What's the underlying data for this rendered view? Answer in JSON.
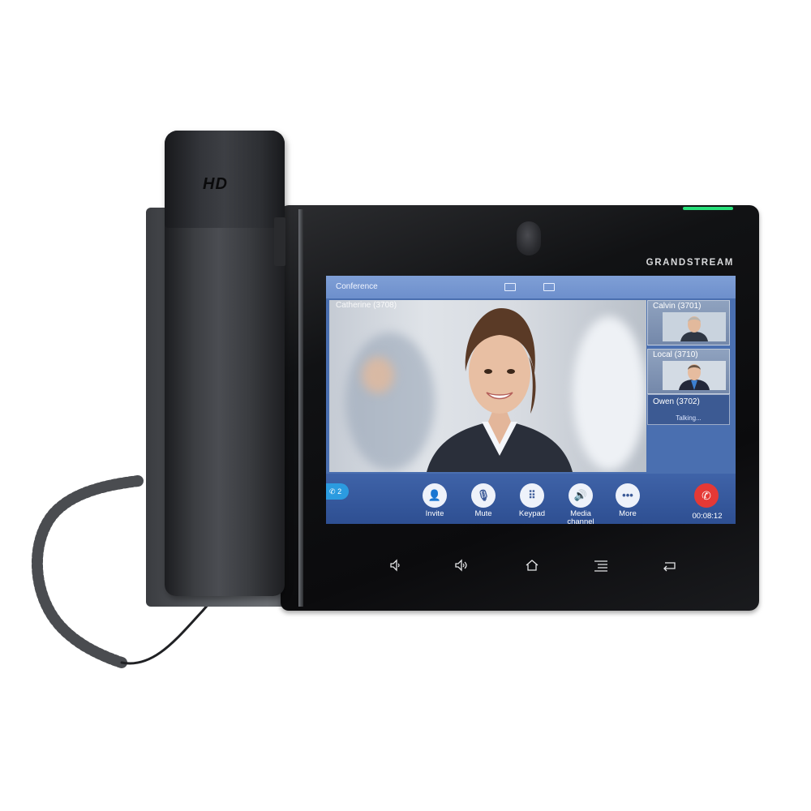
{
  "device": {
    "brand": "GRANDSTREAM",
    "handset_logo": "HD",
    "led_color": "#28e07a"
  },
  "screen": {
    "title": "Conference",
    "layout_icons": [
      "layout-split-icon",
      "layout-grid-icon"
    ],
    "main_video": {
      "caller_name": "Catherine (3708)"
    },
    "participants": [
      {
        "name": "Calvin (3701)"
      },
      {
        "name": "Local (3710)"
      },
      {
        "name": "Owen (3702)",
        "status": "Talking..."
      }
    ],
    "line_badge": {
      "icon": "phone-icon",
      "count": "2"
    },
    "controls": [
      {
        "label": "Invite",
        "icon": "add-person-icon"
      },
      {
        "label": "Mute",
        "icon": "mic-mute-icon"
      },
      {
        "label": "Keypad",
        "icon": "keypad-icon"
      },
      {
        "label": "Media channel",
        "icon": "speaker-icon"
      },
      {
        "label": "More",
        "icon": "more-dots-icon"
      }
    ],
    "end_call": {
      "icon": "hangup-icon",
      "color": "#e53935"
    },
    "timer": "00:08:12"
  },
  "nav_keys": [
    "volume-down-icon",
    "volume-up-icon",
    "home-icon",
    "menu-icon",
    "back-icon"
  ]
}
